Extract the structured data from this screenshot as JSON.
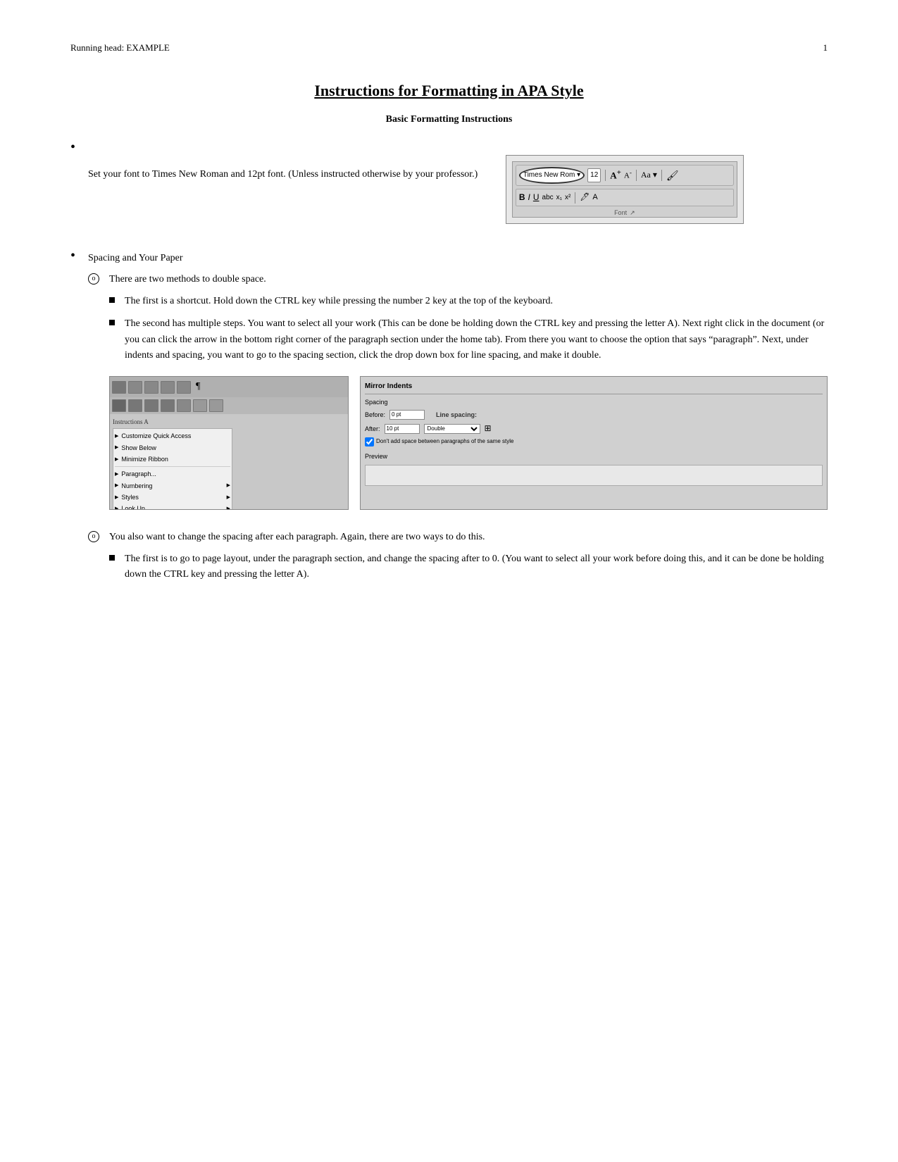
{
  "runningHead": {
    "text": "Running head: EXAMPLE",
    "pageNumber": "1"
  },
  "title": "Instructions for Formatting in APA Style",
  "subtitle": "Basic Formatting Instructions",
  "bullets": [
    {
      "text": "Set your font to Times New Roman and 12pt font. (Unless instructed otherwise by your professor.)",
      "hasImage": true,
      "imageAlt": "Font toolbar screenshot"
    },
    {
      "text": "Spacing and Your Paper",
      "hasImage": false,
      "subItems": [
        {
          "text": "There are two methods to double space.",
          "squareBullets": [
            "The first is a shortcut. Hold down the CTRL key while pressing the number 2 key at the top of the keyboard.",
            "The second has multiple steps. You want to select all your work (This can be done be holding down the CTRL key and pressing the letter A). Next right click in the document (or you can click the arrow in the bottom right corner of the paragraph section under the home tab). From there you want to choose the option that says “paragraph”. Next, under indents and spacing, you want to go to the spacing section, click the drop down box for line spacing, and make it double."
          ],
          "hasScreenshots": true
        },
        {
          "text": "You also want to change the spacing after each paragraph. Again, there are two ways to do this.",
          "squareBullets": [
            "The first is to go to page layout, under the paragraph section, and change the spacing after to 0. (You want to select all your work before doing this, and it can be done be holding down the CTRL key and pressing the letter A)."
          ]
        }
      ]
    }
  ],
  "toolbar": {
    "fontName": "Times New Rom",
    "fontSize": "12",
    "bold": "B",
    "italic": "I",
    "underline": "U"
  },
  "rightPanel": {
    "title": "Mirror Indents",
    "spacingLabel": "Spacing",
    "beforeLabel": "Before:",
    "beforeValue": "0 pt",
    "afterLabel": "After:",
    "afterValue": "10 pt",
    "lineSpacingLabel": "Line spacing:",
    "lineSpacingValue": "Double",
    "checkboxLabel": "Don't add space between paragraphs of the same style",
    "previewLabel": "Preview"
  }
}
